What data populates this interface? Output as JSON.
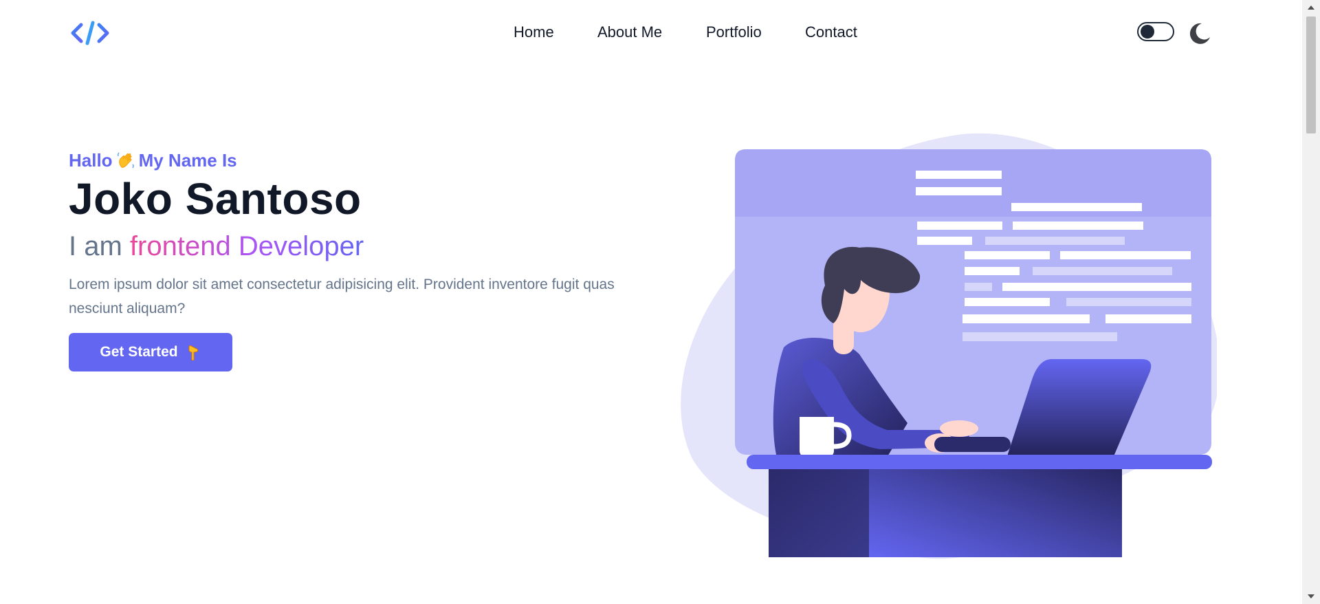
{
  "nav": {
    "items": [
      {
        "label": "Home"
      },
      {
        "label": "About Me"
      },
      {
        "label": "Portfolio"
      },
      {
        "label": "Contact"
      }
    ]
  },
  "hero": {
    "greeting_prefix": "Hallo",
    "greeting_suffix": "My Name Is",
    "name": "Joko Santoso",
    "role_prefix": "I am",
    "role_highlight": "frontend Developer",
    "description": "Lorem ipsum dolor sit amet consectetur adipisicing elit. Provident inventore fugit quas nesciunt aliquam?",
    "cta_label": "Get Started"
  },
  "icons": {
    "logo": "code-brackets-icon",
    "theme_toggle": "toggle-switch-icon",
    "dark_mode": "moon-icon",
    "greeting_emoji": "waving-hand-icon",
    "cta_emoji": "pointing-down-hand-icon"
  },
  "colors": {
    "accent": "#6366f1",
    "heading": "#111827",
    "muted": "#64748b",
    "gradient_start": "#ec4899",
    "gradient_end": "#6366f1"
  }
}
